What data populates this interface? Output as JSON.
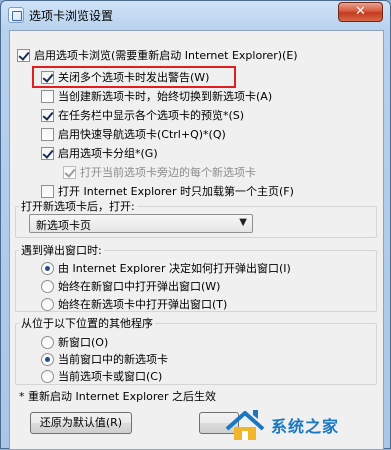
{
  "window": {
    "title": "选项卡浏览设置",
    "close_label": "✕"
  },
  "options": {
    "enable_tabbed": {
      "label": "启用选项卡浏览(需要重新启动 Internet Explorer)(E)",
      "checked": true
    },
    "warn_close_multiple": {
      "label": "关闭多个选项卡时发出警告(W)",
      "checked": true
    },
    "always_switch_new_tab": {
      "label": "当创建新选项卡时，始终切换到新选项卡(A)",
      "checked": false
    },
    "show_previews_taskbar": {
      "label": "在任务栏中显示各个选项卡的预览*(S)",
      "checked": true
    },
    "quick_tabs": {
      "label": "启用快速导航选项卡(Ctrl+Q)*(Q)",
      "checked": false
    },
    "tab_groups": {
      "label": "启用选项卡分组*(G)",
      "checked": true
    },
    "open_next_to_current": {
      "label": "打开当前选项卡旁边的每个新选项卡",
      "checked": true
    },
    "load_first_home_only": {
      "label": "打开 Internet Explorer 时只加载第一个主页(F)",
      "checked": false
    }
  },
  "new_tab_group": {
    "title": "打开新选项卡后，打开:",
    "selected": "新选项卡页",
    "arrow": "▼"
  },
  "popup_group": {
    "title": "遇到弹出窗口时:",
    "options": [
      {
        "label": "由 Internet Explorer 决定如何打开弹出窗口(I)",
        "checked": true
      },
      {
        "label": "始终在新窗口中打开弹出窗口(W)",
        "checked": false
      },
      {
        "label": "始终在新选项卡中打开弹出窗口(T)",
        "checked": false
      }
    ]
  },
  "external_group": {
    "title": "从位于以下位置的其他程序",
    "options": [
      {
        "label": "新窗口(O)",
        "checked": false
      },
      {
        "label": "当前窗口中的新选项卡",
        "checked": true
      },
      {
        "label": "当前选项卡或窗口(C)",
        "checked": false
      }
    ]
  },
  "footnote": "* 重新启动 Internet Explorer 之后生效",
  "buttons": {
    "restore_defaults": "还原为默认值(R)"
  },
  "watermark": {
    "text": "系统之家"
  },
  "colors": {
    "highlight_box": "#e02020",
    "watermark_blue": "#1a78c2"
  }
}
